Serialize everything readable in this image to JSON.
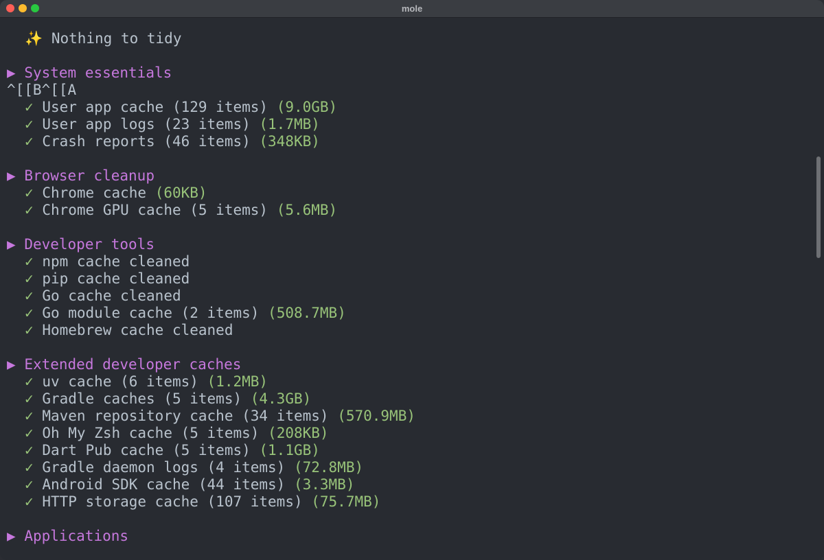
{
  "window": {
    "title": "mole"
  },
  "terminal": {
    "status": {
      "icon": "✨",
      "text": "Nothing to tidy"
    },
    "escape_line": "^[[B^[[A",
    "section_marker": "▶",
    "check_marker": "✓",
    "sections": [
      {
        "title": "System essentials",
        "items": [
          {
            "label": "User app cache (129 items) ",
            "size": "(9.0GB)"
          },
          {
            "label": "User app logs (23 items) ",
            "size": "(1.7MB)"
          },
          {
            "label": "Crash reports (46 items) ",
            "size": "(348KB)"
          }
        ]
      },
      {
        "title": "Browser cleanup",
        "items": [
          {
            "label": "Chrome cache ",
            "size": "(60KB)"
          },
          {
            "label": "Chrome GPU cache (5 items) ",
            "size": "(5.6MB)"
          }
        ]
      },
      {
        "title": "Developer tools",
        "items": [
          {
            "label": "npm cache cleaned",
            "size": ""
          },
          {
            "label": "pip cache cleaned",
            "size": ""
          },
          {
            "label": "Go cache cleaned",
            "size": ""
          },
          {
            "label": "Go module cache (2 items) ",
            "size": "(508.7MB)"
          },
          {
            "label": "Homebrew cache cleaned",
            "size": ""
          }
        ]
      },
      {
        "title": "Extended developer caches",
        "items": [
          {
            "label": "uv cache (6 items) ",
            "size": "(1.2MB)"
          },
          {
            "label": "Gradle caches (5 items) ",
            "size": "(4.3GB)"
          },
          {
            "label": "Maven repository cache (34 items) ",
            "size": "(570.9MB)"
          },
          {
            "label": "Oh My Zsh cache (5 items) ",
            "size": "(208KB)"
          },
          {
            "label": "Dart Pub cache (5 items) ",
            "size": "(1.1GB)"
          },
          {
            "label": "Gradle daemon logs (4 items) ",
            "size": "(72.8MB)"
          },
          {
            "label": "Android SDK cache (44 items) ",
            "size": "(3.3MB)"
          },
          {
            "label": "HTTP storage cache (107 items) ",
            "size": "(75.7MB)"
          }
        ]
      },
      {
        "title": "Applications",
        "items": []
      }
    ]
  }
}
